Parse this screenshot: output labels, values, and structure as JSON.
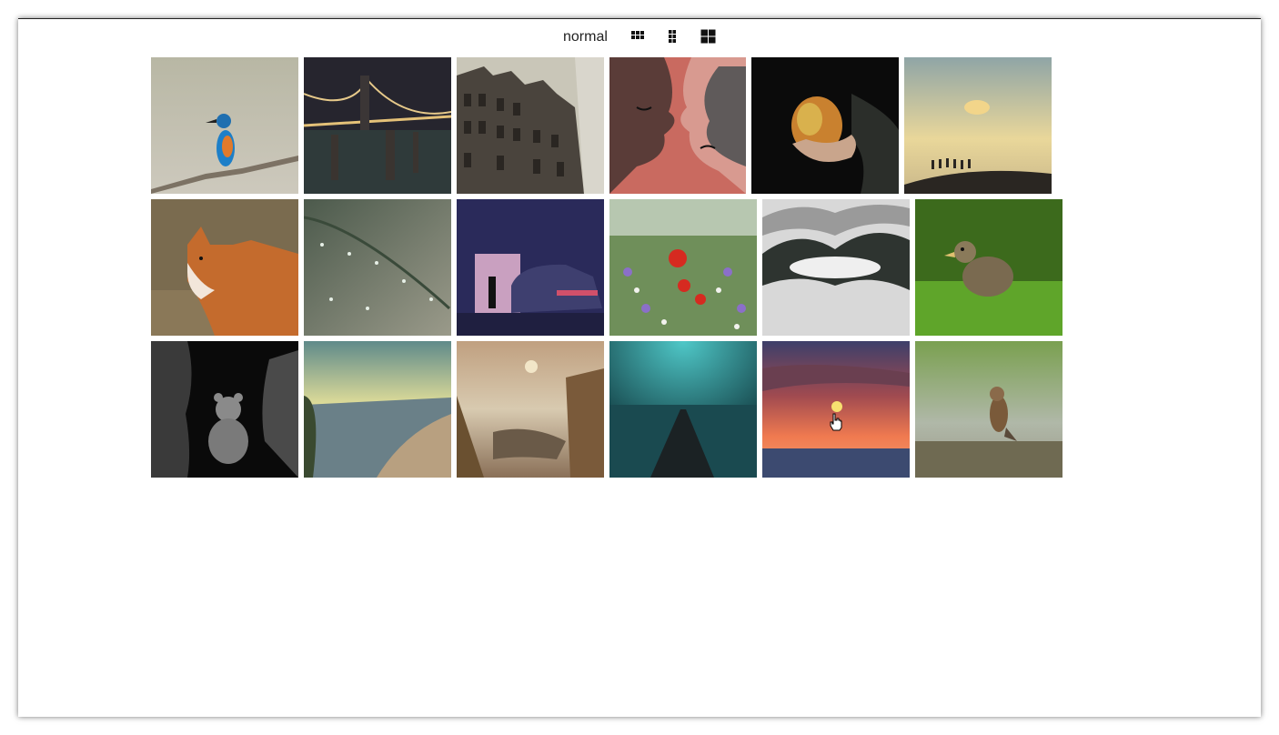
{
  "toolbar": {
    "view_label": "normal",
    "buttons": [
      {
        "icon": "grid-3x3-icon"
      },
      {
        "icon": "grid-2x3-icon"
      },
      {
        "icon": "grid-2x2-icon"
      }
    ]
  },
  "gallery": {
    "images": [
      {
        "subject": "kingfisher-on-branch"
      },
      {
        "subject": "brooklyn-bridge-night"
      },
      {
        "subject": "amsterdam-houses"
      },
      {
        "subject": "kissing-faces-illustration"
      },
      {
        "subject": "hand-holding-apple"
      },
      {
        "subject": "silhouettes-on-hill-sunset"
      },
      {
        "subject": "red-fox"
      },
      {
        "subject": "dew-on-branch"
      },
      {
        "subject": "man-beside-car-night"
      },
      {
        "subject": "wildflower-meadow"
      },
      {
        "subject": "fog-over-forest"
      },
      {
        "subject": "duckling-in-grass"
      },
      {
        "subject": "girl-with-teddy-bear"
      },
      {
        "subject": "lake-with-birds-sunset"
      },
      {
        "subject": "heron-in-misty-reeds"
      },
      {
        "subject": "pier-under-starry-sky"
      },
      {
        "subject": "sunset-over-sea"
      },
      {
        "subject": "sparrow-on-log"
      }
    ]
  }
}
